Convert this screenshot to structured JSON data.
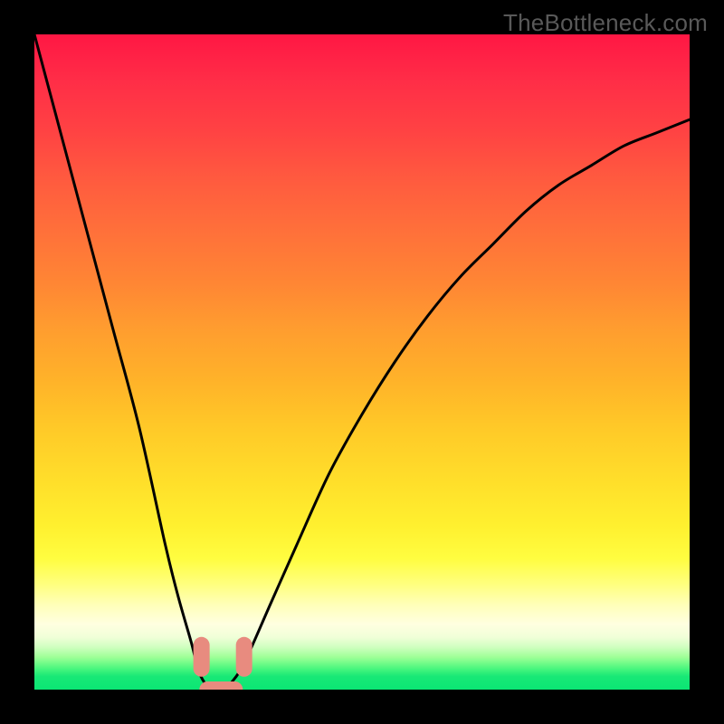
{
  "watermark": "TheBottleneck.com",
  "chart_data": {
    "type": "line",
    "title": "",
    "xlabel": "",
    "ylabel": "",
    "xlim": [
      0,
      100
    ],
    "ylim": [
      0,
      100
    ],
    "series": [
      {
        "name": "bottleneck-curve",
        "x": [
          0,
          4,
          8,
          12,
          16,
          20,
          22,
          24,
          25,
          26,
          27,
          28,
          29,
          30,
          32,
          36,
          40,
          45,
          50,
          55,
          60,
          65,
          70,
          75,
          80,
          85,
          90,
          95,
          100
        ],
        "y": [
          100,
          85,
          70,
          55,
          40,
          22,
          14,
          7,
          3,
          1,
          0,
          0,
          0,
          1,
          4,
          13,
          22,
          33,
          42,
          50,
          57,
          63,
          68,
          73,
          77,
          80,
          83,
          85,
          87
        ]
      }
    ],
    "annotations": [
      {
        "name": "marker-left",
        "x": 25.5,
        "y": 5
      },
      {
        "name": "marker-right",
        "x": 32,
        "y": 5
      },
      {
        "name": "marker-bottom",
        "x": 28.5,
        "y": 0
      }
    ],
    "grid": false,
    "legend": false
  }
}
